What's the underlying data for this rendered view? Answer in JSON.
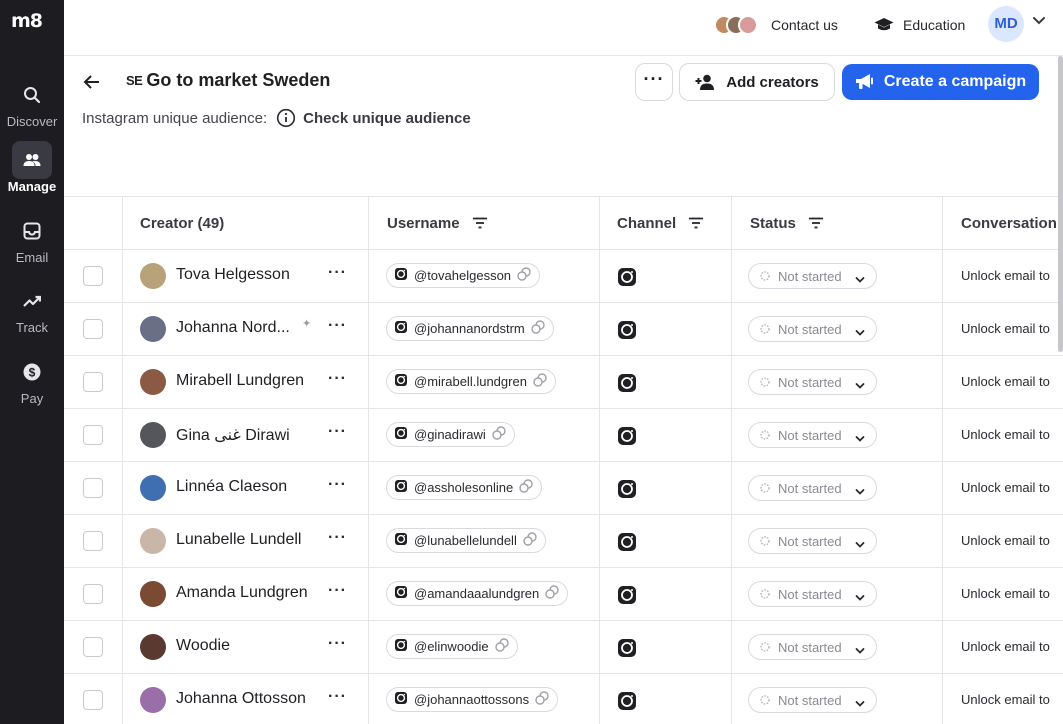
{
  "app": {
    "logo": "m8"
  },
  "sidebar": {
    "items": [
      {
        "label": "Discover",
        "icon": "search-icon"
      },
      {
        "label": "Manage",
        "icon": "users-icon",
        "active": true
      },
      {
        "label": "Email",
        "icon": "inbox-icon"
      },
      {
        "label": "Track",
        "icon": "trend-icon"
      },
      {
        "label": "Pay",
        "icon": "dollar-icon"
      }
    ]
  },
  "topbar": {
    "contact_label": "Contact us",
    "education_label": "Education",
    "user_initials": "MD"
  },
  "header": {
    "flag": "SE",
    "title": "Go to market Sweden",
    "add_creators_label": "Add creators",
    "create_campaign_label": "Create a campaign",
    "audience_label": "Instagram unique audience:",
    "audience_link": "Check unique audience"
  },
  "table": {
    "columns": [
      "Creator (49)",
      "Username",
      "Channel",
      "Status",
      "Conversation"
    ],
    "rows": [
      {
        "name": "Tova Helgesson",
        "username": "@tovahelgesson",
        "status": "Not started",
        "conversation": "Unlock email to",
        "avatar_color": "#b7a27a"
      },
      {
        "name": "Johanna Nord...",
        "username": "@johannanordstrm",
        "status": "Not started",
        "conversation": "Unlock email to",
        "avatar_color": "#6b6f86",
        "sparkle": true
      },
      {
        "name": "Mirabell Lundgren",
        "username": "@mirabell.lundgren",
        "status": "Not started",
        "conversation": "Unlock email to",
        "avatar_color": "#8a5a44"
      },
      {
        "name": "Gina غنى Dirawi",
        "username": "@ginadirawi",
        "status": "Not started",
        "conversation": "Unlock email to",
        "avatar_color": "#55555c"
      },
      {
        "name": "Linnéa Claeson",
        "username": "@assholesonline",
        "status": "Not started",
        "conversation": "Unlock email to",
        "avatar_color": "#3f6fb0"
      },
      {
        "name": "Lunabelle Lundell",
        "username": "@lunabellelundell",
        "status": "Not started",
        "conversation": "Unlock email to",
        "avatar_color": "#c9b6a6"
      },
      {
        "name": "Amanda Lundgren",
        "username": "@amandaaalundgren",
        "status": "Not started",
        "conversation": "Unlock email to",
        "avatar_color": "#7a4a32"
      },
      {
        "name": "Woodie",
        "username": "@elinwoodie",
        "status": "Not started",
        "conversation": "Unlock email to",
        "avatar_color": "#5a3a30"
      },
      {
        "name": "Johanna Ottosson",
        "username": "@johannaottossons",
        "status": "Not started",
        "conversation": "Unlock email to",
        "avatar_color": "#9a6ea8"
      }
    ]
  },
  "colors": {
    "sidebar_bg": "#1c1c21",
    "primary": "#2463eb",
    "avatar_bg": "#dbe6ff"
  }
}
